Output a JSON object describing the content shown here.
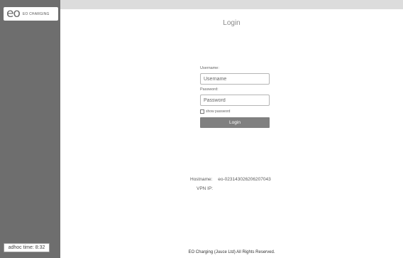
{
  "sidebar": {
    "logo_mark": "eo",
    "logo_text": "EO CHARGING",
    "adhoc_time": "adhoc time: 8:32"
  },
  "main": {
    "title": "Login",
    "form": {
      "username_label": "Username:",
      "username_placeholder": "Username",
      "password_label": "Password:",
      "password_placeholder": "Password",
      "show_password_label": "show password",
      "show_password_checked": false,
      "login_button": "Login"
    },
    "info": {
      "hostname_label": "Hostname:",
      "hostname_value": "eo-023143026206207043",
      "vpn_label": "VPN IP:",
      "vpn_value": ""
    },
    "footer": "EO Charging (Juuce Ltd) All Rights Reserved."
  },
  "colors": {
    "sidebar_bg": "#6e6e6e",
    "page_bg": "#dcdcdc",
    "button_bg": "#808080"
  }
}
